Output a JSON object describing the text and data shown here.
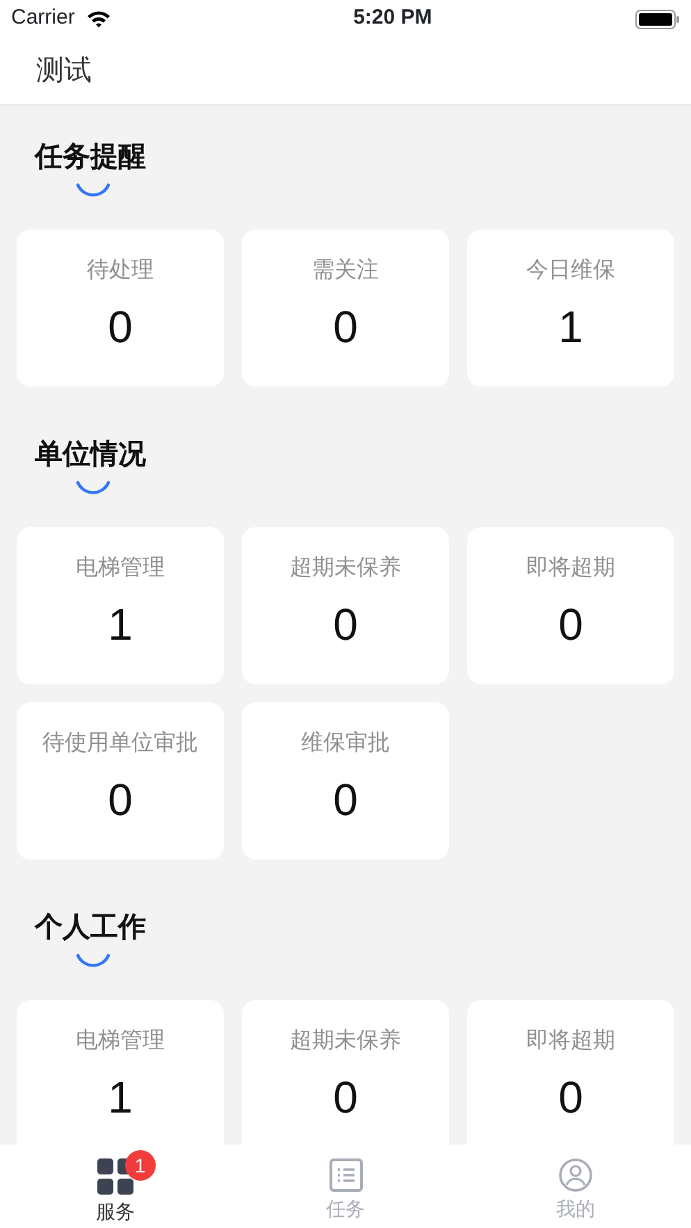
{
  "status_bar": {
    "carrier": "Carrier",
    "time": "5:20 PM"
  },
  "nav": {
    "title": "测试"
  },
  "sections": [
    {
      "title": "任务提醒",
      "cards": [
        {
          "label": "待处理",
          "value": "0"
        },
        {
          "label": "需关注",
          "value": "0"
        },
        {
          "label": "今日维保",
          "value": "1"
        }
      ]
    },
    {
      "title": "单位情况",
      "cards": [
        {
          "label": "电梯管理",
          "value": "1"
        },
        {
          "label": "超期未保养",
          "value": "0"
        },
        {
          "label": "即将超期",
          "value": "0"
        },
        {
          "label": "待使用单位审批",
          "value": "0"
        },
        {
          "label": "维保审批",
          "value": "0"
        }
      ]
    },
    {
      "title": "个人工作",
      "cards": [
        {
          "label": "电梯管理",
          "value": "1"
        },
        {
          "label": "超期未保养",
          "value": "0"
        },
        {
          "label": "即将超期",
          "value": "0"
        }
      ]
    }
  ],
  "tabs": [
    {
      "kind": "grid",
      "label": "服务",
      "selected": true,
      "badge": "1"
    },
    {
      "kind": "list",
      "label": "任务",
      "selected": false
    },
    {
      "kind": "person",
      "label": "我的",
      "selected": false
    }
  ]
}
